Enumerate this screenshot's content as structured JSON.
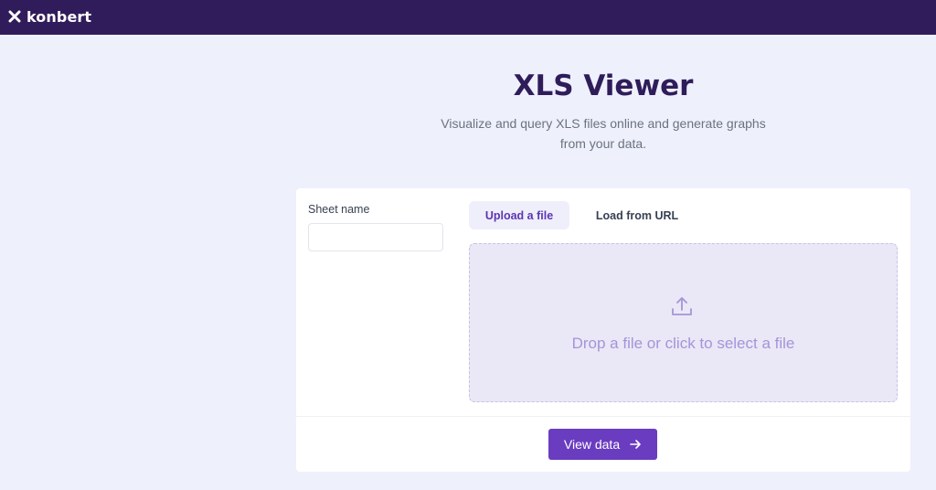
{
  "header": {
    "brand": "konbert"
  },
  "hero": {
    "title": "XLS Viewer",
    "subtitle": "Visualize and query XLS files online and generate graphs from your data."
  },
  "form": {
    "sheet_label": "Sheet name",
    "sheet_value": "",
    "sheet_placeholder": "",
    "tabs": [
      {
        "label": "Upload a file",
        "active": true
      },
      {
        "label": "Load from URL",
        "active": false
      }
    ],
    "dropzone_text": "Drop a file or click to select a file",
    "submit_label": "View data"
  },
  "icons": {
    "logo": "konbert-x-logo-icon",
    "upload": "upload-icon",
    "submit": "arrow-right-icon"
  },
  "colors": {
    "topbar": "#311c5b",
    "page_bg": "#eef0fc",
    "title": "#2f1d5a",
    "accent": "#6a3cc0",
    "dropzone_bg": "#eae8f6",
    "dropzone_text": "#a594d9"
  }
}
